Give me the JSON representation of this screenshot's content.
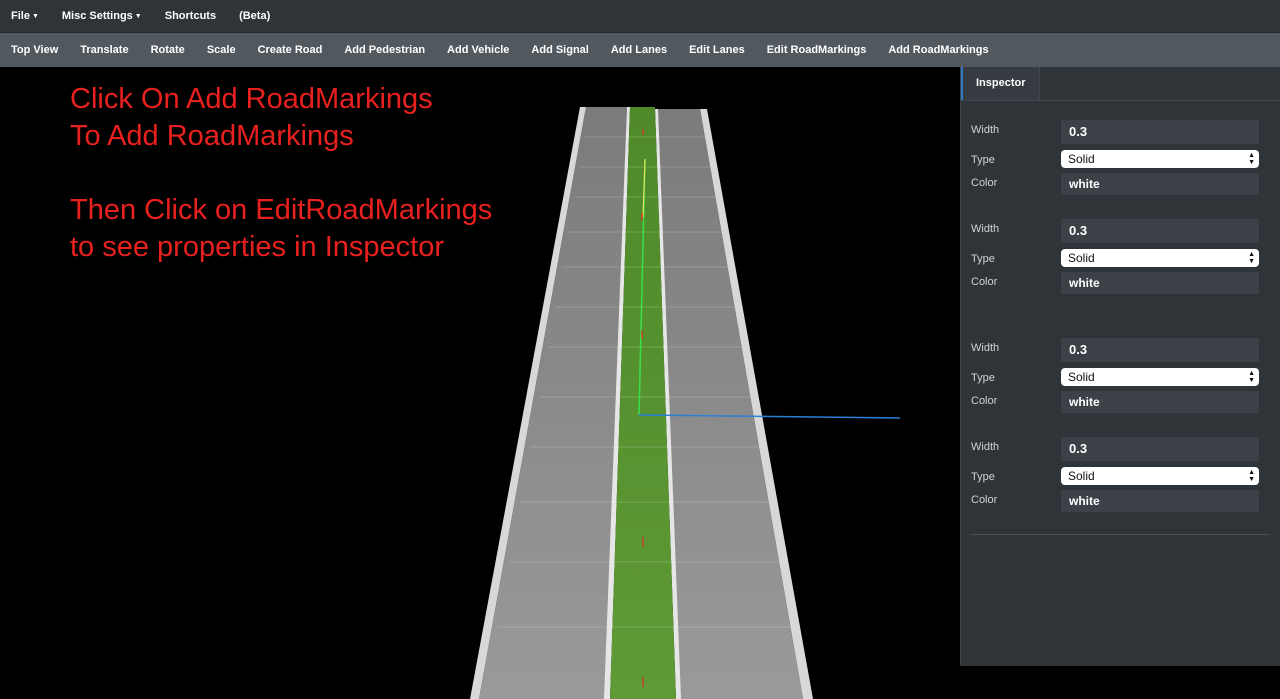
{
  "menubar": {
    "items": [
      {
        "label": "File",
        "has_caret": true
      },
      {
        "label": "Misc Settings",
        "has_caret": true
      },
      {
        "label": "Shortcuts",
        "has_caret": false
      },
      {
        "label": "(Beta)",
        "has_caret": false
      }
    ]
  },
  "toolbar": {
    "buttons": [
      "Top View",
      "Translate",
      "Rotate",
      "Scale",
      "Create Road",
      "Add Pedestrian",
      "Add Vehicle",
      "Add Signal",
      "Add Lanes",
      "Edit Lanes",
      "Edit RoadMarkings",
      "Add RoadMarkings"
    ]
  },
  "viewport": {
    "instruction_lines": [
      "Click On Add RoadMarkings",
      "To Add RoadMarkings",
      "Then Click on EditRoadMarkings",
      "to see properties in Inspector"
    ]
  },
  "inspector": {
    "tab_label": "Inspector",
    "labels": {
      "width": "Width",
      "type": "Type",
      "color": "Color"
    },
    "markings": [
      {
        "width": "0.3",
        "type": "Solid",
        "color": "white"
      },
      {
        "width": "0.3",
        "type": "Solid",
        "color": "white"
      },
      {
        "width": "0.3",
        "type": "Solid",
        "color": "white"
      },
      {
        "width": "0.3",
        "type": "Solid",
        "color": "white"
      }
    ]
  },
  "colors": {
    "menubar_bg": "#2f3438",
    "toolbar_bg": "#51585e",
    "overlay_text": "#e8201e",
    "inspector_bg": "#2f3438",
    "accent": "#2a7ac4"
  }
}
